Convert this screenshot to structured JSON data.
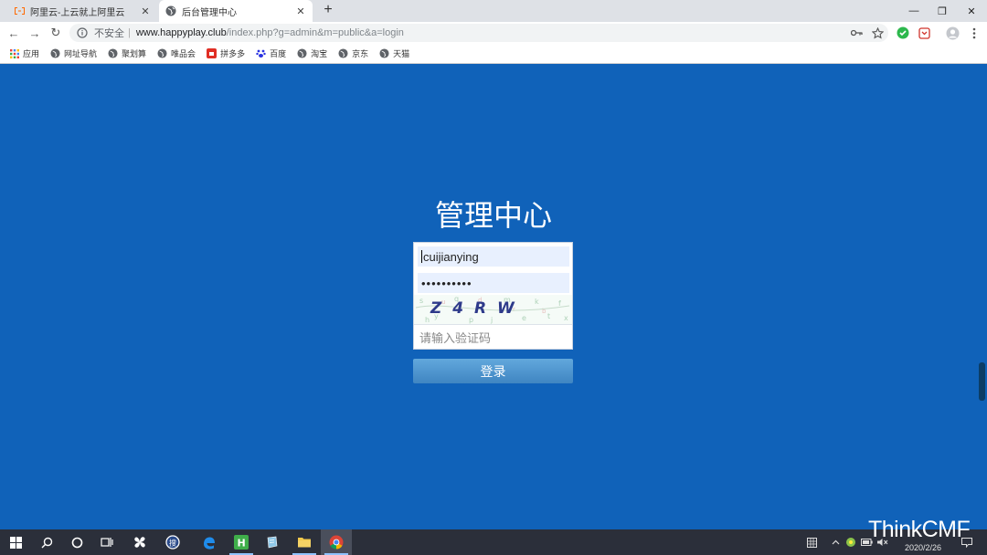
{
  "browser": {
    "tabs": [
      {
        "title": "阿里云-上云就上阿里云",
        "close": "✕"
      },
      {
        "title": "后台管理中心",
        "close": "✕"
      }
    ],
    "new_tab": "+",
    "window_controls": {
      "minimize": "—",
      "maximize": "❐",
      "close": "✕"
    },
    "nav": {
      "back": "←",
      "forward": "→",
      "reload": "↻"
    },
    "address": {
      "insecure_label": "不安全",
      "separator": "|",
      "host": "www.happyplay.club",
      "path": "/index.php?g=admin&m=public&a=login"
    }
  },
  "bookmarks": [
    {
      "label": "应用",
      "icon": "apps-grid-icon"
    },
    {
      "label": "网址导航",
      "icon": "globe-icon"
    },
    {
      "label": "聚划算",
      "icon": "globe-icon"
    },
    {
      "label": "唯品会",
      "icon": "globe-icon"
    },
    {
      "label": "拼多多",
      "icon": "pinduoduo-icon"
    },
    {
      "label": "百度",
      "icon": "baidu-paw-icon"
    },
    {
      "label": "淘宝",
      "icon": "globe-icon"
    },
    {
      "label": "京东",
      "icon": "globe-icon"
    },
    {
      "label": "天猫",
      "icon": "globe-icon"
    }
  ],
  "login": {
    "title": "管理中心",
    "username": "cuijianying",
    "password_mask": "••••••••••",
    "captcha_text": "Z 4 R W",
    "captcha_placeholder": "请输入验证码",
    "submit_label": "登录"
  },
  "taskbar": {
    "clock_date": "2020/2/26"
  },
  "watermark": "ThinkCMF",
  "colors": {
    "page_background": "#1062b9",
    "button_top": "#62a8dc",
    "button_bottom": "#3f85c2",
    "autofill_background": "#e8f0fe"
  }
}
